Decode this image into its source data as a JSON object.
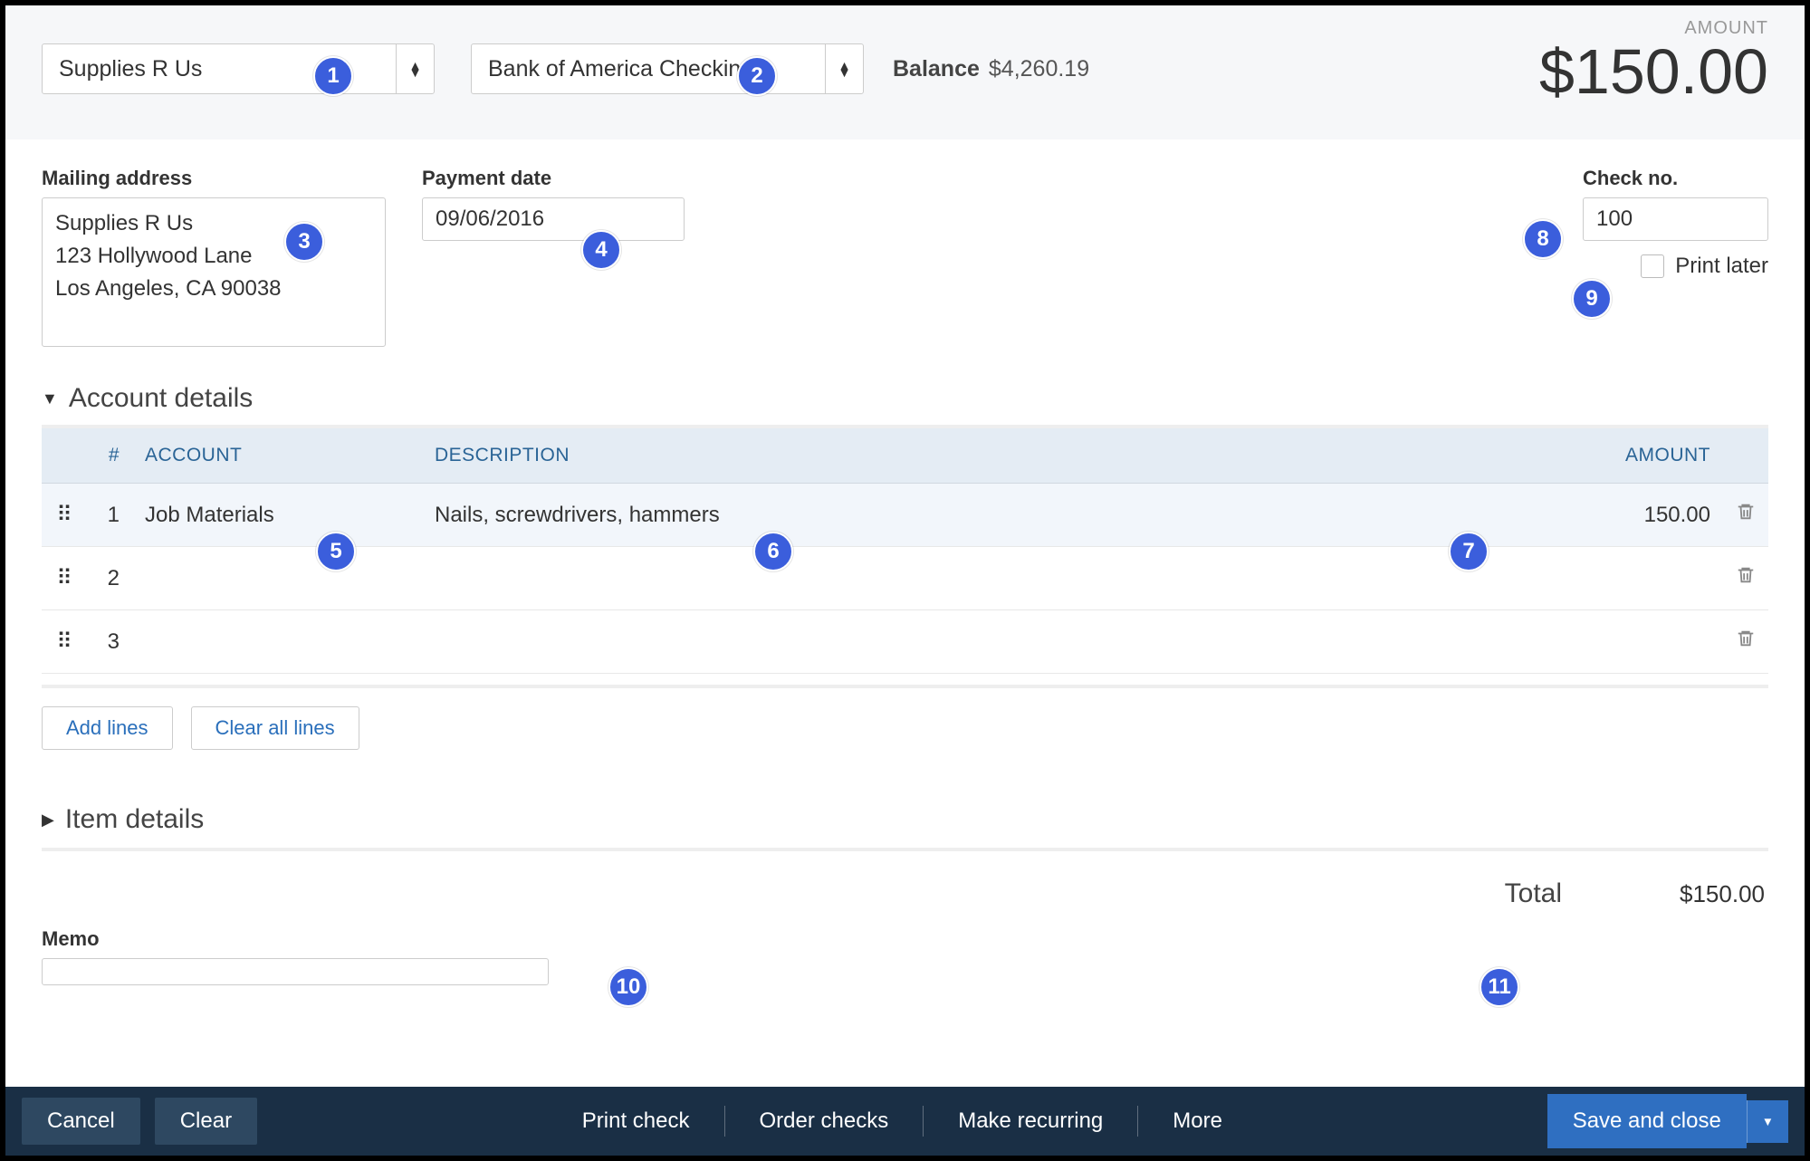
{
  "header": {
    "payee": "Supplies R Us",
    "bank_account": "Bank of America Checking",
    "balance_label": "Balance",
    "balance_value": "$4,260.19",
    "amount_label": "AMOUNT",
    "amount_value": "$150.00"
  },
  "fields": {
    "mailing_address_label": "Mailing address",
    "mailing_address": "Supplies R Us\n123 Hollywood Lane\nLos Angeles, CA  90038",
    "payment_date_label": "Payment date",
    "payment_date": "09/06/2016",
    "check_no_label": "Check no.",
    "check_no": "100",
    "print_later_label": "Print later"
  },
  "sections": {
    "account_details": "Account details",
    "item_details": "Item details"
  },
  "table": {
    "col_num": "#",
    "col_account": "ACCOUNT",
    "col_description": "DESCRIPTION",
    "col_amount": "AMOUNT",
    "rows": [
      {
        "num": "1",
        "account": "Job Materials",
        "description": "Nails, screwdrivers, hammers",
        "amount": "150.00"
      },
      {
        "num": "2",
        "account": "",
        "description": "",
        "amount": ""
      },
      {
        "num": "3",
        "account": "",
        "description": "",
        "amount": ""
      }
    ]
  },
  "buttons": {
    "add_lines": "Add lines",
    "clear_lines": "Clear all lines"
  },
  "totals": {
    "label": "Total",
    "value": "$150.00"
  },
  "memo_label": "Memo",
  "footer": {
    "cancel": "Cancel",
    "clear": "Clear",
    "print_check": "Print check",
    "order_checks": "Order checks",
    "make_recurring": "Make recurring",
    "more": "More",
    "save_close": "Save and close"
  },
  "markers": {
    "1": "1",
    "2": "2",
    "3": "3",
    "4": "4",
    "5": "5",
    "6": "6",
    "7": "7",
    "8": "8",
    "9": "9",
    "10": "10",
    "11": "11"
  }
}
